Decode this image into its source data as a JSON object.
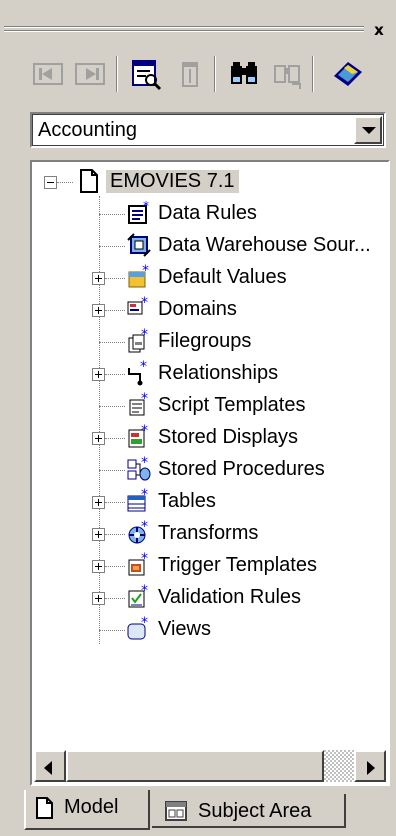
{
  "window": {
    "close_label": "x"
  },
  "toolbar": {
    "buttons": [
      {
        "icon": "prev-icon",
        "enabled": false
      },
      {
        "icon": "next-icon",
        "enabled": false
      },
      {
        "icon": "properties-icon",
        "enabled": true
      },
      {
        "icon": "delete-icon",
        "enabled": false
      },
      {
        "icon": "find-icon",
        "enabled": true
      },
      {
        "icon": "find-replace-icon",
        "enabled": false
      },
      {
        "icon": "help-icon",
        "enabled": true
      }
    ]
  },
  "subject_area": {
    "selected": "Accounting"
  },
  "tree": {
    "root": {
      "label": "EMOVIES  7.1",
      "expanded": true
    },
    "items": [
      {
        "label": "Data Rules",
        "expandable": false,
        "icon": "data-rules-icon"
      },
      {
        "label": "Data Warehouse Sour...",
        "expandable": false,
        "icon": "data-warehouse-icon"
      },
      {
        "label": "Default Values",
        "expandable": true,
        "icon": "default-values-icon"
      },
      {
        "label": "Domains",
        "expandable": true,
        "icon": "domains-icon"
      },
      {
        "label": "Filegroups",
        "expandable": false,
        "icon": "filegroups-icon"
      },
      {
        "label": "Relationships",
        "expandable": true,
        "icon": "relationships-icon"
      },
      {
        "label": "Script Templates",
        "expandable": false,
        "icon": "script-templates-icon"
      },
      {
        "label": "Stored Displays",
        "expandable": true,
        "icon": "stored-displays-icon"
      },
      {
        "label": "Stored Procedures",
        "expandable": false,
        "icon": "stored-procedures-icon"
      },
      {
        "label": "Tables",
        "expandable": true,
        "icon": "tables-icon"
      },
      {
        "label": "Transforms",
        "expandable": true,
        "icon": "transforms-icon"
      },
      {
        "label": "Trigger Templates",
        "expandable": true,
        "icon": "trigger-templates-icon"
      },
      {
        "label": "Validation Rules",
        "expandable": true,
        "icon": "validation-rules-icon"
      },
      {
        "label": "Views",
        "expandable": false,
        "icon": "views-icon"
      }
    ]
  },
  "tabs": [
    {
      "label": "Model",
      "active": true,
      "icon": "model-tab-icon"
    },
    {
      "label": "Subject Area",
      "active": false,
      "icon": "subject-area-tab-icon"
    }
  ]
}
